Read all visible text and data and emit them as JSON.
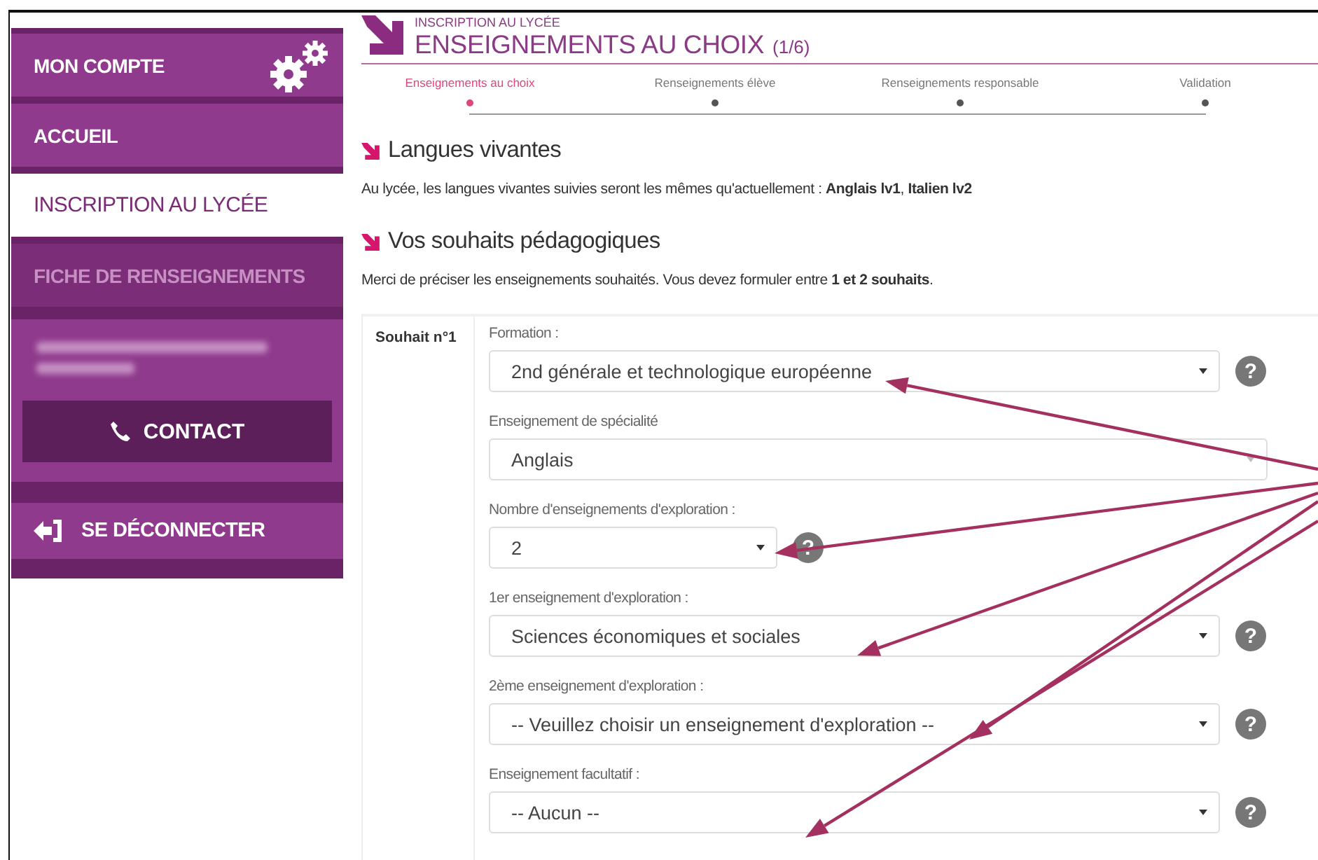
{
  "sidebar": {
    "items": [
      {
        "label": "MON COMPTE",
        "kind": "account",
        "selected": false,
        "disabled": false
      },
      {
        "label": "ACCUEIL",
        "kind": "link",
        "selected": false,
        "disabled": false
      },
      {
        "label": "INSCRIPTION AU LYCÉE",
        "kind": "link",
        "selected": true,
        "disabled": false
      },
      {
        "label": "FICHE DE RENSEIGNEMENTS",
        "kind": "link",
        "selected": false,
        "disabled": true
      }
    ],
    "contact": {
      "label": "CONTACT"
    },
    "logout": {
      "label": "SE DÉCONNECTER"
    }
  },
  "header": {
    "subtitle": "INSCRIPTION AU LYCÉE",
    "title": "ENSEIGNEMENTS AU CHOIX",
    "counter": "(1/6)"
  },
  "steps": [
    {
      "label": "Enseignements au choix",
      "selected": true
    },
    {
      "label": "Renseignements élève",
      "selected": false
    },
    {
      "label": "Renseignements responsable",
      "selected": false
    },
    {
      "label": "Validation",
      "selected": false
    }
  ],
  "sections": [
    {
      "title": "Langues vivantes",
      "text": "Au lycée, les langues vivantes suivies seront les mêmes qu'actuellement : **Anglais lv1**, **Italien lv2**"
    },
    {
      "title": "Vos souhaits pédagogiques",
      "text": "Merci de préciser les enseignements souhaités. Vous devez formuler entre **1 et 2 souhaits**."
    }
  ],
  "wish": {
    "label": "Souhait n°1",
    "fields": [
      {
        "label": "Formation :",
        "value": "2nd générale et technologique européenne",
        "kind": "select",
        "help": "?"
      },
      {
        "label": "Enseignement de spécialité",
        "value": "Anglais",
        "kind": "wide"
      },
      {
        "label": "Nombre d'enseignements d'exploration :",
        "value": "2",
        "kind": "short",
        "help": "?"
      },
      {
        "label": "1er enseignement d'exploration :",
        "value": "Sciences économiques et sociales",
        "kind": "select",
        "help": "?"
      },
      {
        "label": "2ème enseignement d'exploration :",
        "value": "-- Veuillez choisir un enseignement d'exploration --",
        "kind": "select",
        "help": "?"
      },
      {
        "label": "Enseignement facultatif :",
        "value": "-- Aucun --",
        "kind": "select",
        "help": "?"
      }
    ]
  }
}
